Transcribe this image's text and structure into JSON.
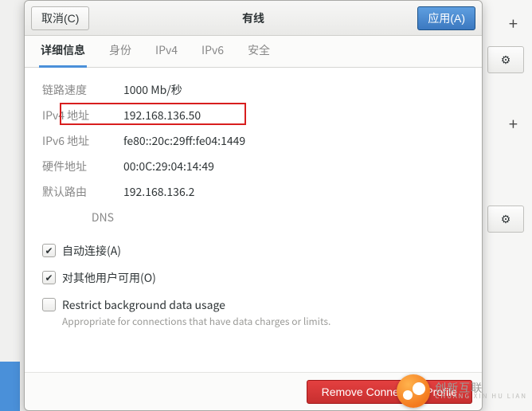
{
  "window": {
    "title": "有线",
    "cancel_label": "取消(C)",
    "apply_label": "应用(A)"
  },
  "tabs": {
    "details": "详细信息",
    "identity": "身份",
    "ipv4": "IPv4",
    "ipv6": "IPv6",
    "security": "安全"
  },
  "details": {
    "link_speed_label": "链路速度",
    "link_speed_value": "1000 Mb/秒",
    "ipv4_addr_label": "IPv4 地址",
    "ipv4_addr_value": "192.168.136.50",
    "ipv6_addr_label": "IPv6 地址",
    "ipv6_addr_value": "fe80::20c:29ff:fe04:1449",
    "hw_addr_label": "硬件地址",
    "hw_addr_value": "00:0C:29:04:14:49",
    "default_route_label": "默认路由",
    "default_route_value": "192.168.136.2",
    "dns_label": "DNS",
    "dns_value": ""
  },
  "options": {
    "auto_connect_label": "自动连接(A)",
    "available_all_label": "对其他用户可用(O)",
    "restrict_bg_label": "Restrict background data usage",
    "restrict_bg_sub": "Appropriate for connections that have data charges or limits."
  },
  "footer": {
    "remove_label": "Remove Connection Profile"
  },
  "watermark": {
    "brand": "创新互联",
    "sub": "CHUANG XIN HU LIAN"
  },
  "bg_icons": {
    "plus": "+",
    "gear": "⚙"
  }
}
